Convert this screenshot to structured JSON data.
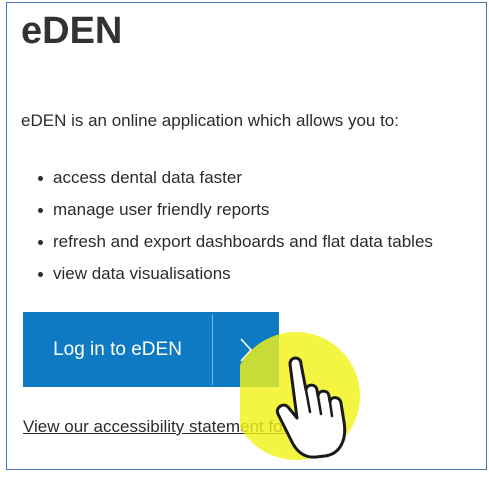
{
  "page": {
    "title": "eDEN",
    "intro": "eDEN is an online application which allows you to:",
    "features": [
      "access dental data faster",
      "manage user friendly reports",
      "refresh and export dashboards and flat data tables",
      "view data visualisations"
    ],
    "login_button": {
      "label": "Log in to eDEN",
      "icon": "chevron-right-icon"
    },
    "accessibility_link": "View our accessibility statement for eDEN"
  },
  "overlay": {
    "icon": "hand-pointer-icon",
    "highlight_color": "#f2f21a"
  },
  "colors": {
    "button": "#0f7ac4",
    "border": "#4a78b4",
    "text": "#2b2b2b"
  }
}
